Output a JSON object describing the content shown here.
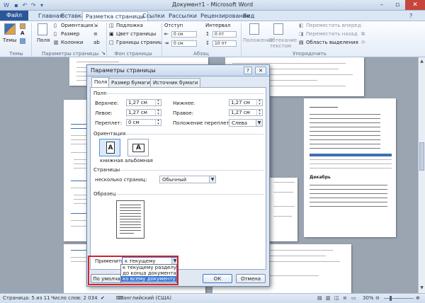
{
  "window": {
    "title": "Документ1 - Microsoft Word"
  },
  "tabs": [
    "Файл",
    "Главная",
    "Вставка",
    "Разметка страницы",
    "Ссылки",
    "Рассылки",
    "Рецензирование",
    "Вид"
  ],
  "ribbon": {
    "themes_label": "Темы",
    "fields_label": "Поля",
    "orientation": "Ориентация",
    "size": "Размер",
    "columns": "Колонки",
    "substrate": "Подложка",
    "page_color": "Цвет страницы",
    "page_borders": "Границы страниц",
    "indent": "Отступ",
    "interval": "Интервал",
    "indent_left": "0 см",
    "indent_right": "0 см",
    "space_before": "0 пт",
    "space_after": "10 пт",
    "position": "Положение",
    "wrap_text": "Обтекание текстом",
    "bring_forward": "Переместить вперед",
    "send_backward": "Переместить назад",
    "selection_pane": "Область выделения",
    "group_themes": "Темы",
    "group_page_setup": "Параметры страницы",
    "group_page_bg": "Фон страницы",
    "group_paragraph": "Абзац",
    "group_arrange": "Упорядочить"
  },
  "dialog": {
    "title": "Параметры страницы",
    "help": "?",
    "close": "✕",
    "tabs": [
      "Поля",
      "Размер бумаги",
      "Источник бумаги"
    ],
    "fields_header": "Поля",
    "top_label": "Верхнее:",
    "top_value": "1,27 см",
    "bottom_label": "Нижнее:",
    "bottom_value": "1,27 см",
    "left_label": "Левое:",
    "left_value": "1,27 см",
    "right_label": "Правое:",
    "right_value": "1,27 см",
    "gutter_label": "Переплет:",
    "gutter_value": "0 см",
    "gutter_pos_label": "Положение переплета:",
    "gutter_pos_value": "Слева",
    "orientation_header": "Ориентация",
    "portrait": "книжная",
    "landscape": "альбомная",
    "pages_header": "Страницы",
    "multiple_pages_label": "несколько страниц:",
    "multiple_pages_value": "Обычный",
    "sample_header": "Образец",
    "apply_label": "Применить:",
    "apply_value": "к текущему разделу",
    "apply_options": [
      "к текущему разделу",
      "до конца документа",
      "ко всему документу"
    ],
    "default_button": "По умолчанию",
    "ok_button": "ОК",
    "cancel_button": "Отмена"
  },
  "preview_pages": {
    "dekabr": "Декабрь"
  },
  "status": {
    "page": "Страница: 5 из 11",
    "words": "Число слов: 2 034",
    "language": "английский (США)",
    "zoom": "30%"
  }
}
